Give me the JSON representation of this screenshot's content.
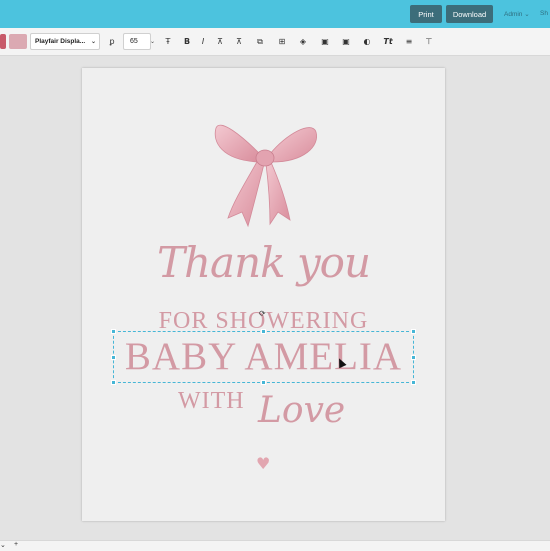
{
  "header": {
    "print_label": "Print",
    "download_label": "Download",
    "admin_label": "Admin",
    "admin_chevron": "⌄",
    "share_label": "Sh"
  },
  "toolbar": {
    "font_name": "Playfair Displa...",
    "font_size": "65",
    "icons": [
      "text-style-icon",
      "letter-spacing-icon",
      "bold-icon",
      "italic-icon",
      "align-icon",
      "effects-icon",
      "duplicate-icon",
      "layers-icon",
      "position-icon",
      "lock-icon",
      "color-icon",
      "text-transform-icon",
      "line-height-icon",
      "distribute-icon"
    ],
    "glyphs": {
      "text_style": "ꝑ",
      "spacing": "Ŧ",
      "bold": "B",
      "italic": "I",
      "align": "⊼",
      "effects": "⧉",
      "dup": "⊞",
      "layers": "◈",
      "pos": "▣",
      "lock": "▣",
      "color": "◐",
      "tt": "Tt",
      "lh": "≡",
      "dist": "⊤"
    }
  },
  "canvas": {
    "thank_you": "Thank you",
    "for_showering": "FOR SHOWERING",
    "baby_name": "BABY AMELIA",
    "with": "WITH",
    "love": "Love",
    "heart": "♥"
  },
  "footer": {
    "minus": "⌄",
    "plus": "+"
  },
  "colors": {
    "accent": "#4cc3de",
    "button": "#3c6d7a",
    "text_pink": "#d39aa4",
    "selection": "#46b6d6"
  }
}
